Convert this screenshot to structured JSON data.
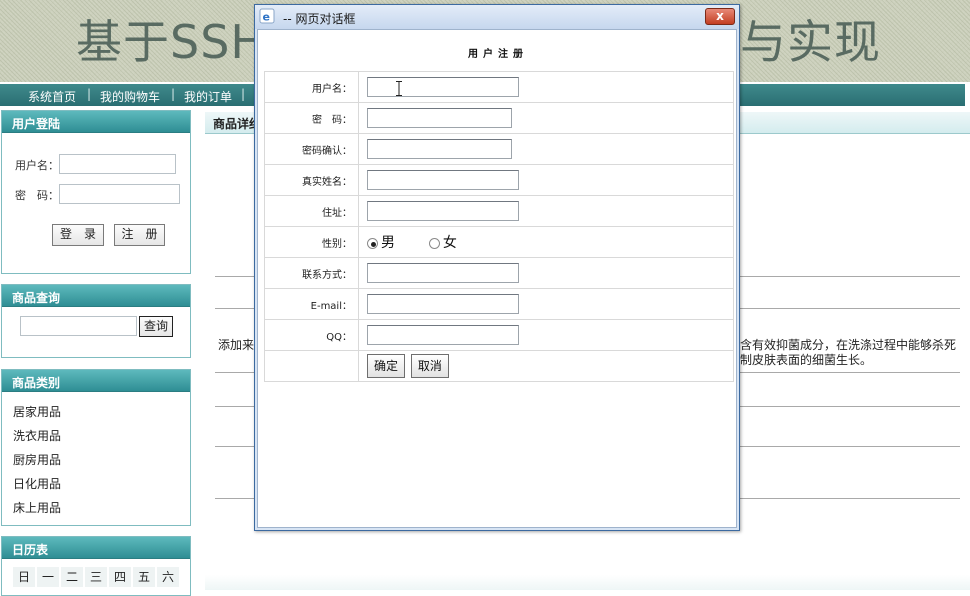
{
  "banner": {
    "title_left": "基于SSH",
    "title_right": "与实现"
  },
  "nav": {
    "items": [
      "系统首页",
      "我的购物车",
      "我的订单"
    ],
    "separator": "|"
  },
  "login_panel": {
    "title": "用户登陆",
    "username_label": "用户名：",
    "password_label": "密　码：",
    "login_button": "登　录",
    "register_button": "注　册"
  },
  "search_panel": {
    "title": "商品查询",
    "search_button": "查询"
  },
  "category_panel": {
    "title": "商品类别",
    "items": [
      "居家用品",
      "洗衣用品",
      "厨房用品",
      "日化用品",
      "床上用品"
    ]
  },
  "calendar_panel": {
    "title": "日历表",
    "weekdays": [
      "日",
      "一",
      "二",
      "三",
      "四",
      "五",
      "六"
    ]
  },
  "main": {
    "title": "商品详细",
    "text_left": "添加来",
    "text_right_1": "含有效抑菌成分，在洗涤过程中能够杀死",
    "text_right_2": "制皮肤表面的细菌生长。"
  },
  "dialog": {
    "title": "-- 网页对话框",
    "close_label": "x",
    "form_title": "用户注册",
    "fields": {
      "username": "用户名：",
      "password": "密　码：",
      "password_confirm": "密码确认：",
      "realname": "真实姓名：",
      "address": "住址：",
      "gender": "性别：",
      "phone": "联系方式：",
      "email": "E-mail：",
      "qq": "QQ："
    },
    "gender_options": {
      "male": "男",
      "female": "女",
      "selected": "male"
    },
    "submit_button": "确定",
    "cancel_button": "取消"
  }
}
